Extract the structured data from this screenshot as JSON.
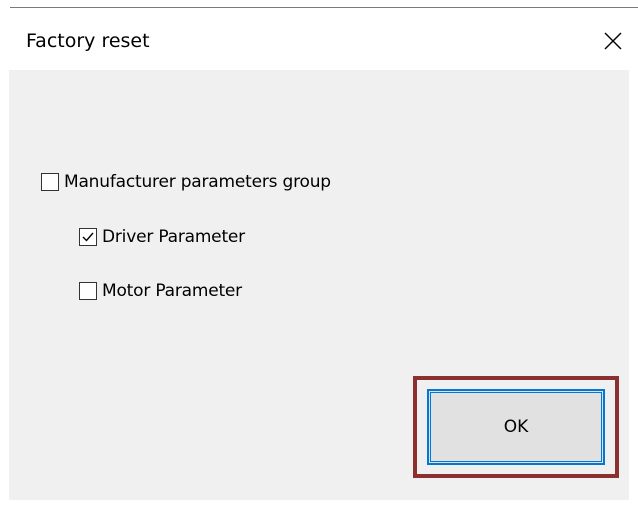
{
  "dialog": {
    "title": "Factory reset",
    "close_icon": "close-icon"
  },
  "options": [
    {
      "label": "Manufacturer parameters group",
      "checked": false
    },
    {
      "label": "Driver Parameter",
      "checked": true
    },
    {
      "label": "Motor Parameter",
      "checked": false
    }
  ],
  "buttons": {
    "ok_label": "OK"
  },
  "colors": {
    "client_bg": "#f0f0f0",
    "focus_border": "#0078d7",
    "highlight_border": "#8c2f2f",
    "button_bg": "#e1e1e1"
  }
}
